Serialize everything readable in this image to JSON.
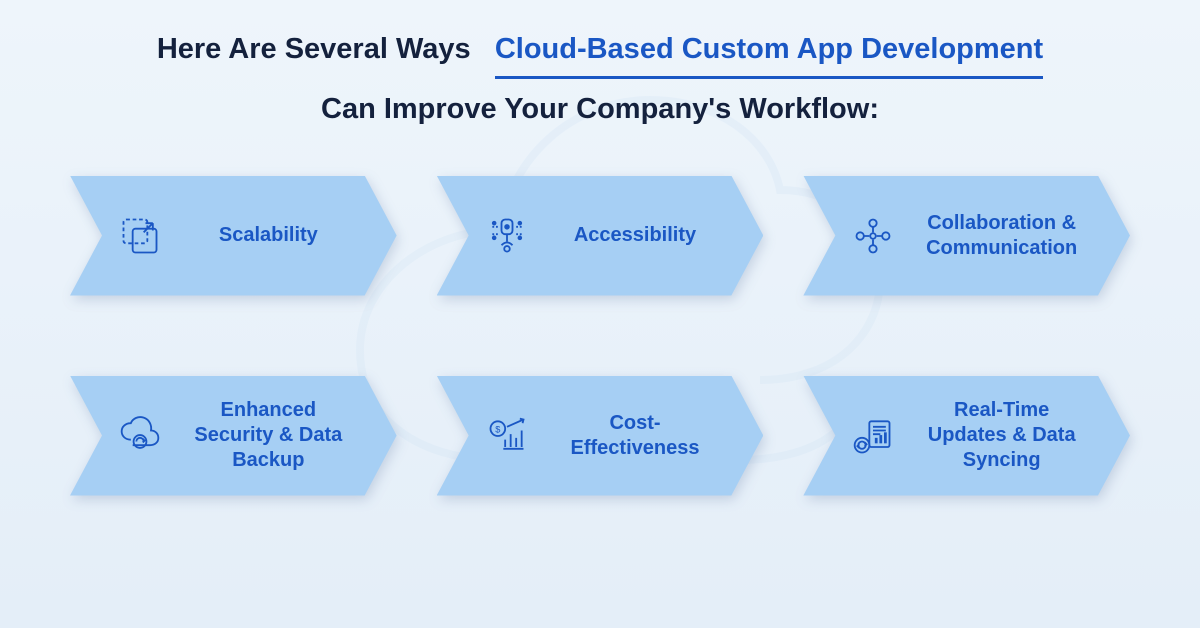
{
  "heading": {
    "part1": "Here Are Several Ways",
    "highlight": "Cloud-Based Custom App Development",
    "part2": "Can Improve Your Company's Workflow:"
  },
  "cards": [
    {
      "label": "Scalability",
      "icon": "scale-icon"
    },
    {
      "label": "Accessibility",
      "icon": "accessibility-icon"
    },
    {
      "label": "Collaboration & Communication",
      "icon": "collaboration-icon"
    },
    {
      "label": "Enhanced Security & Data Backup",
      "icon": "security-backup-icon"
    },
    {
      "label": "Cost-Effectiveness",
      "icon": "cost-icon"
    },
    {
      "label": "Real-Time Updates & Data Syncing",
      "icon": "sync-icon"
    }
  ]
}
